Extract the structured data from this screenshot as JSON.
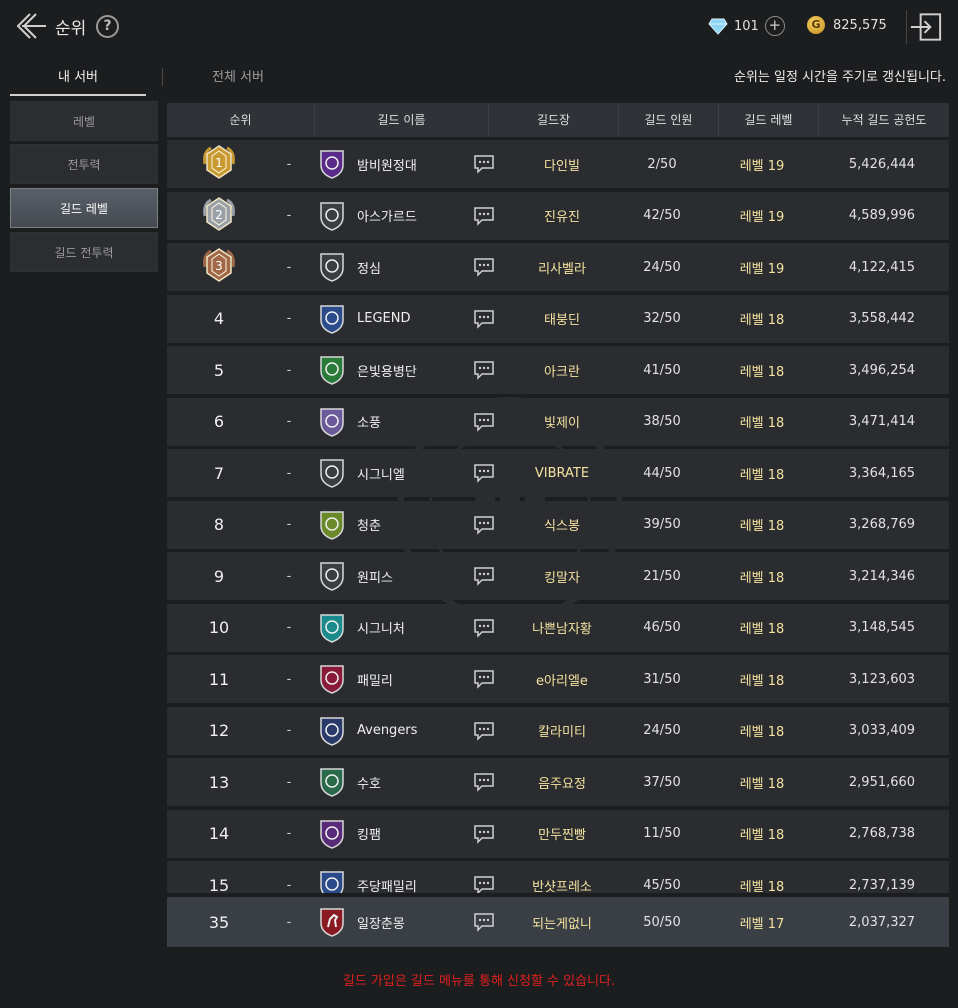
{
  "header": {
    "title": "순위",
    "help": "?",
    "gems": "101",
    "plus": "+",
    "gold_symbol": "G",
    "gold": "825,575"
  },
  "tabs": {
    "mine": "내 서버",
    "all": "전체 서버"
  },
  "notice_top": "순위는 일정 시간을 주기로 갱신됩니다.",
  "side_menu": [
    {
      "label": "레벨"
    },
    {
      "label": "전투력"
    },
    {
      "label": "길드 레벨",
      "active": true
    },
    {
      "label": "길드 전투력"
    }
  ],
  "columns": {
    "rank": "순위",
    "name": "길드 이름",
    "master": "길드장",
    "members": "길드 인원",
    "level": "길드 레벨",
    "contrib": "누적 길드 공헌도"
  },
  "rows": [
    {
      "rank": "1",
      "change": "-",
      "emblem": "v-shield-purple-icon",
      "name": "밤비원정대",
      "master": "다인빌",
      "members": "2/50",
      "level": "레벨 19",
      "contrib": "5,426,444"
    },
    {
      "rank": "2",
      "change": "-",
      "emblem": "star-badge-icon",
      "name": "아스가르드",
      "master": "진유진",
      "members": "42/50",
      "level": "레벨 19",
      "contrib": "4,589,996"
    },
    {
      "rank": "3",
      "change": "-",
      "emblem": "wolf-badge-icon",
      "name": "정심",
      "master": "리사벨라",
      "members": "24/50",
      "level": "레벨 19",
      "contrib": "4,122,415"
    },
    {
      "rank": "4",
      "change": "-",
      "emblem": "blue-cross-badge-icon",
      "name": "LEGEND",
      "master": "태붕딘",
      "members": "32/50",
      "level": "레벨 18",
      "contrib": "3,558,442"
    },
    {
      "rank": "5",
      "change": "-",
      "emblem": "green-dragon-badge-icon",
      "name": "은빛용병단",
      "master": "아크란",
      "members": "41/50",
      "level": "레벨 18",
      "contrib": "3,496,254"
    },
    {
      "rank": "6",
      "change": "-",
      "emblem": "purple-shield-icon",
      "name": "소풍",
      "master": "빛제이",
      "members": "38/50",
      "level": "레벨 18",
      "contrib": "3,471,414"
    },
    {
      "rank": "7",
      "change": "-",
      "emblem": "crossed-axes-icon",
      "name": "시그니엘",
      "master": "VIBRATE",
      "members": "44/50",
      "level": "레벨 18",
      "contrib": "3,364,165"
    },
    {
      "rank": "8",
      "change": "-",
      "emblem": "green-shield-icon",
      "name": "청춘",
      "master": "식스봉",
      "members": "39/50",
      "level": "레벨 18",
      "contrib": "3,268,769"
    },
    {
      "rank": "9",
      "change": "-",
      "emblem": "wolf-shield-icon",
      "name": "원피스",
      "master": "킹말자",
      "members": "21/50",
      "level": "레벨 18",
      "contrib": "3,214,346"
    },
    {
      "rank": "10",
      "change": "-",
      "emblem": "teal-diamond-icon",
      "name": "시그니처",
      "master": "나쁜남자황",
      "members": "46/50",
      "level": "레벨 18",
      "contrib": "3,148,545"
    },
    {
      "rank": "11",
      "change": "-",
      "emblem": "v-shield-red-icon",
      "name": "패밀리",
      "master": "e아리엘e",
      "members": "31/50",
      "level": "레벨 18",
      "contrib": "3,123,603"
    },
    {
      "rank": "12",
      "change": "-",
      "emblem": "navy-shield-icon",
      "name": "Avengers",
      "master": "칼라미티",
      "members": "24/50",
      "level": "레벨 18",
      "contrib": "3,033,409"
    },
    {
      "rank": "13",
      "change": "-",
      "emblem": "green-horse-badge-icon",
      "name": "수호",
      "master": "음주요정",
      "members": "37/50",
      "level": "레벨 18",
      "contrib": "2,951,660"
    },
    {
      "rank": "14",
      "change": "-",
      "emblem": "purple-star-badge-icon",
      "name": "킹팸",
      "master": "만두찐빵",
      "members": "11/50",
      "level": "레벨 18",
      "contrib": "2,768,738"
    },
    {
      "rank": "15",
      "change": "-",
      "emblem": "horse-shield-icon",
      "name": "주당패밀리",
      "master": "반샷프레소",
      "members": "45/50",
      "level": "레벨 18",
      "contrib": "2,737,139"
    }
  ],
  "my_guild": {
    "rank": "35",
    "change": "-",
    "emblem": "red-horse-shield-icon",
    "name": "일장춘몽",
    "master": "되는게없니",
    "members": "50/50",
    "level": "레벨 17",
    "contrib": "2,037,327"
  },
  "footer_notice": "길드 가입은 길드 메뉴를 통해 신청할 수 있습니다.",
  "colors": {
    "accent_gold": "#f4e2a0",
    "notice_red": "#e0201f",
    "active_tab": "#5a6068"
  }
}
